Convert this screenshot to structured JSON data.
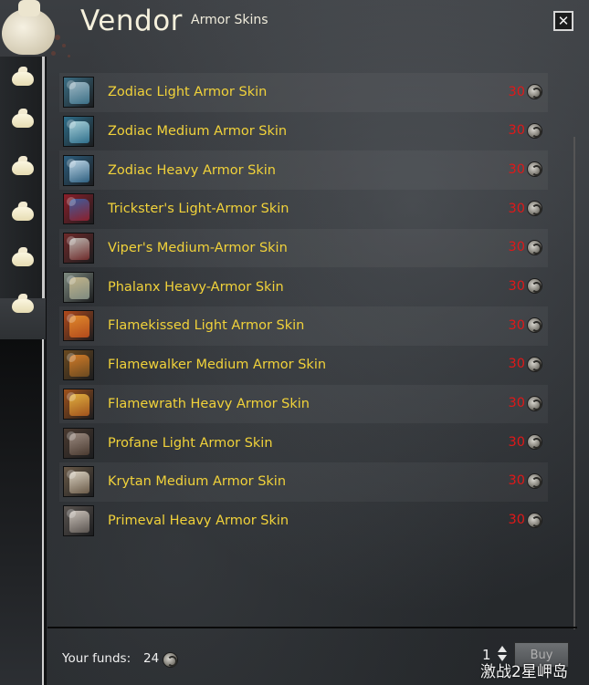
{
  "header": {
    "title": "Vendor",
    "subtitle": "Armor Skins",
    "close_label": "✕"
  },
  "tabs": [
    {
      "icon": "bag-icon"
    },
    {
      "icon": "bag-icon"
    },
    {
      "icon": "bag-icon"
    },
    {
      "icon": "bag-icon"
    },
    {
      "icon": "bag-icon"
    },
    {
      "icon": "bag-icon",
      "active": true
    }
  ],
  "items": [
    {
      "name": "Zodiac Light Armor Skin",
      "price": "30",
      "icon": "zodiac-light-icon"
    },
    {
      "name": "Zodiac Medium Armor Skin",
      "price": "30",
      "icon": "zodiac-medium-icon"
    },
    {
      "name": "Zodiac Heavy Armor Skin",
      "price": "30",
      "icon": "zodiac-heavy-icon"
    },
    {
      "name": "Trickster's Light-Armor Skin",
      "price": "30",
      "icon": "trickster-light-icon"
    },
    {
      "name": "Viper's Medium-Armor Skin",
      "price": "30",
      "icon": "viper-medium-icon"
    },
    {
      "name": "Phalanx Heavy-Armor Skin",
      "price": "30",
      "icon": "phalanx-heavy-icon"
    },
    {
      "name": "Flamekissed Light Armor Skin",
      "price": "30",
      "icon": "flamekissed-light-icon"
    },
    {
      "name": "Flamewalker Medium Armor Skin",
      "price": "30",
      "icon": "flamewalker-medium-icon"
    },
    {
      "name": "Flamewrath Heavy Armor Skin",
      "price": "30",
      "icon": "flamewrath-heavy-icon"
    },
    {
      "name": "Profane Light Armor Skin",
      "price": "30",
      "icon": "profane-light-icon"
    },
    {
      "name": "Krytan Medium Armor Skin",
      "price": "30",
      "icon": "krytan-medium-icon"
    },
    {
      "name": "Primeval Heavy Armor Skin",
      "price": "30",
      "icon": "primeval-heavy-icon"
    }
  ],
  "footer": {
    "funds_label": "Your funds:",
    "funds_value": "24",
    "quantity": "1",
    "buy_label": "Buy"
  },
  "watermark": "激战2星岬岛",
  "colors": {
    "item_name": "#f1d23a",
    "price": "#e01818",
    "icon_palettes": [
      [
        "#3b6f86",
        "#9fb8c4"
      ],
      [
        "#2f6f8c",
        "#a8d0d8"
      ],
      [
        "#2d5f80",
        "#bcd4e4"
      ],
      [
        "#8c1f2a",
        "#3e5d9e"
      ],
      [
        "#6e2a2a",
        "#b9b6b0"
      ],
      [
        "#7e8a80",
        "#c2b48a"
      ],
      [
        "#b24a1c",
        "#e08a2c"
      ],
      [
        "#6b4a20",
        "#d07a28"
      ],
      [
        "#a0521c",
        "#e0b040"
      ],
      [
        "#4a3a30",
        "#9a8a80"
      ],
      [
        "#6a5a48",
        "#d8d0c0"
      ],
      [
        "#5a5450",
        "#c8c0b8"
      ]
    ]
  }
}
